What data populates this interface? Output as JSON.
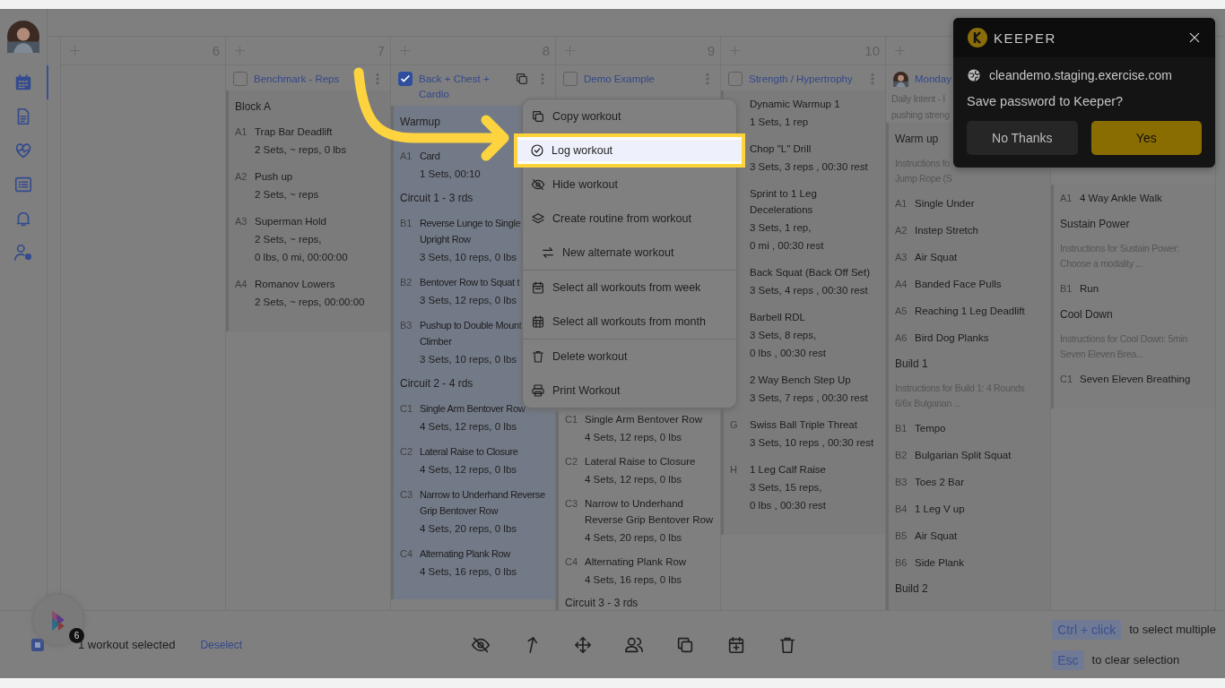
{
  "sidebar": {
    "items": [
      {
        "kind": "calendar",
        "selected": true
      },
      {
        "kind": "document",
        "selected": false
      },
      {
        "kind": "heart",
        "selected": false
      },
      {
        "kind": "list",
        "selected": false
      },
      {
        "kind": "bell",
        "selected": false
      },
      {
        "kind": "user-settings",
        "selected": false
      }
    ]
  },
  "columns": [
    {
      "day": "6",
      "add_button": true
    },
    {
      "day": "7",
      "add_button": true,
      "workouts": [
        {
          "title": "Benchmark - Reps",
          "checked": false,
          "sections": [
            {
              "heading": "Block A",
              "exercises": [
                {
                  "code": "A1",
                  "name": "Trap Bar Deadlift",
                  "details": [
                    "2 Sets, ~ reps, 0 lbs"
                  ]
                },
                {
                  "code": "A2",
                  "name": "Push up",
                  "details": [
                    "2 Sets, ~ reps"
                  ]
                },
                {
                  "code": "A3",
                  "name": "Superman Hold",
                  "details": [
                    "2 Sets, ~ reps,",
                    "0 lbs, 0 mi, 00:00:00"
                  ]
                },
                {
                  "code": "A4",
                  "name": "Romanov Lowers",
                  "details": [
                    "2 Sets, ~ reps, 00:00:00"
                  ]
                }
              ]
            }
          ]
        }
      ]
    },
    {
      "day": "8",
      "add_button": true,
      "workouts": [
        {
          "title": "Back + Chest + Cardio",
          "checked": true,
          "copy_icon": true,
          "sections": [
            {
              "heading": "Warmup",
              "exercises": [
                {
                  "code": "A1",
                  "name": "Card",
                  "details": [
                    "1 Sets, 00:10"
                  ]
                }
              ]
            },
            {
              "heading": "Circuit 1 - 3 rds",
              "exercises": [
                {
                  "code": "B1",
                  "name": "Reverse Lunge to Single Upright Row",
                  "details": [
                    "3 Sets, 10 reps, 0 lbs"
                  ]
                },
                {
                  "code": "B2",
                  "name": "Bentover Row to Squat t",
                  "details": [
                    "3 Sets, 12 reps, 0 lbs"
                  ]
                },
                {
                  "code": "B3",
                  "name": "Pushup to Double Mount Climber",
                  "details": [
                    "3 Sets, 10 reps, 0 lbs"
                  ]
                }
              ]
            },
            {
              "heading": "Circuit 2 - 4 rds",
              "exercises": [
                {
                  "code": "C1",
                  "name": "Single Arm Bentover Row",
                  "details": [
                    "4 Sets, 12 reps, 0 lbs"
                  ]
                },
                {
                  "code": "C2",
                  "name": "Lateral Raise to Closure",
                  "details": [
                    "4 Sets, 12 reps, 0 lbs"
                  ]
                },
                {
                  "code": "C3",
                  "name": "Narrow to Underhand Reverse Grip Bentover Row",
                  "details": [
                    "4 Sets, 20 reps, 0 lbs"
                  ]
                },
                {
                  "code": "C4",
                  "name": "Alternating Plank Row",
                  "details": [
                    "4 Sets, 16 reps, 0 lbs"
                  ]
                }
              ]
            }
          ]
        }
      ]
    },
    {
      "day": "9",
      "add_button": true,
      "workouts": [
        {
          "title": "Demo Example",
          "checked": false,
          "sections": [
            {
              "exercises": [
                {
                  "code": "C1",
                  "name": "Single Arm Bentover Row",
                  "details": [
                    "4 Sets, 12 reps, 0 lbs"
                  ]
                },
                {
                  "code": "C2",
                  "name": "Lateral Raise to Closure",
                  "details": [
                    "4 Sets, 12 reps, 0 lbs"
                  ]
                },
                {
                  "code": "C3",
                  "name": "Narrow to Underhand Reverse Grip Bentover Row",
                  "details": [
                    "4 Sets, 20 reps, 0 lbs"
                  ]
                },
                {
                  "code": "C4",
                  "name": "Alternating Plank Row",
                  "details": [
                    "4 Sets, 16 reps, 0 lbs"
                  ]
                }
              ]
            },
            {
              "heading": "Circuit 3 - 3 rds"
            }
          ]
        }
      ]
    },
    {
      "day": "10",
      "add_button": true,
      "workouts": [
        {
          "title": "Strength / Hypertrophy",
          "checked": false,
          "sections": [
            {
              "exercises": [
                {
                  "name": "Dynamic Warmup 1",
                  "details": [
                    "1 Sets, 1 rep"
                  ]
                },
                {
                  "name": "Chop \"L\" Drill",
                  "details": [
                    "3 Sets, 3 reps , 00:30 rest"
                  ]
                },
                {
                  "name": "Sprint to 1 Leg Decelerations",
                  "details": [
                    "3 Sets, 1 rep,",
                    "0 mi , 00:30 rest"
                  ]
                },
                {
                  "name": "Back Squat (Back Off Set)",
                  "details": [
                    "3 Sets, 4 reps , 00:30 rest"
                  ]
                },
                {
                  "name": "Barbell RDL",
                  "details": [
                    "3 Sets, 8 reps,",
                    "0 lbs , 00:30 rest"
                  ]
                },
                {
                  "name": "2 Way Bench Step Up",
                  "details": [
                    "3 Sets, 7 reps , 00:30 rest"
                  ]
                },
                {
                  "code": "G",
                  "name": "Swiss Ball Triple Threat",
                  "details": [
                    "3 Sets, 10 reps , 00:30 rest"
                  ]
                },
                {
                  "code": "H",
                  "name": "1 Leg Calf Raise",
                  "details": [
                    "3 Sets, 15 reps,",
                    "0 lbs , 00:30 rest"
                  ]
                }
              ]
            }
          ]
        }
      ]
    },
    {
      "add_button": true,
      "workouts": [
        {
          "title": "Monday",
          "avatar": true,
          "description": [
            "Daily Intent - I",
            "pushing streng"
          ],
          "sections": [
            {
              "heading": "Warm up",
              "instructions": [
                "Instructions fo",
                "Jump Rope (S"
              ],
              "exercises": [
                {
                  "code": "A1",
                  "name": "Single Under"
                },
                {
                  "code": "A2",
                  "name": "Instep Stretch"
                },
                {
                  "code": "A3",
                  "name": "Air Squat"
                },
                {
                  "code": "A4",
                  "name": "Banded Face Pulls"
                },
                {
                  "code": "A5",
                  "name": "Reaching 1 Leg Deadlift"
                },
                {
                  "code": "A6",
                  "name": "Bird Dog Planks"
                }
              ]
            },
            {
              "heading": "Build 1",
              "instructions": [
                "Instructions for Build 1: 4 Rounds",
                "6/6x Bulgarian ..."
              ],
              "exercises": [
                {
                  "code": "B1",
                  "name": "Tempo"
                },
                {
                  "code": "B2",
                  "name": "Bulgarian Split Squat"
                },
                {
                  "code": "B3",
                  "name": "Toes 2 Bar"
                },
                {
                  "code": "B4",
                  "name": "1 Leg V up"
                },
                {
                  "code": "B5",
                  "name": "Air Squat"
                },
                {
                  "code": "B6",
                  "name": "Side Plank"
                }
              ]
            },
            {
              "heading": "Build 2"
            }
          ]
        }
      ]
    },
    {
      "workouts": [
        {
          "sections": [
            {
              "exercises": [
                {
                  "code": "A1",
                  "name": "4 Way Ankle Walk"
                }
              ]
            },
            {
              "heading": "Sustain Power",
              "instructions": [
                "Instructions for Sustain Power:",
                "Choose a modality ..."
              ],
              "exercises": [
                {
                  "code": "B1",
                  "name": "Run"
                }
              ]
            },
            {
              "heading": "Cool Down",
              "instructions": [
                "Instructions for Cool Down: 5min",
                "Seven Eleven Brea..."
              ],
              "exercises": [
                {
                  "code": "C1",
                  "name": "Seven Eleven Breathing"
                }
              ]
            }
          ]
        }
      ]
    }
  ],
  "context_menu": {
    "items": [
      {
        "label": "Copy workout",
        "kind": "copy",
        "selected": false
      },
      {
        "label": "Log workout",
        "kind": "check-circle",
        "selected": true
      },
      {
        "label": "Hide workout",
        "kind": "eye-off",
        "selected": false
      },
      {
        "label": "Create routine from workout",
        "kind": "layers",
        "selected": false
      },
      {
        "label": "New alternate workout",
        "kind": "swap",
        "selected": false
      },
      {
        "label": "Select all workouts from week",
        "kind": "calendar-week",
        "divider_before": true,
        "selected": false
      },
      {
        "label": "Select all workouts from month",
        "kind": "calendar-month",
        "selected": false
      },
      {
        "label": "Delete workout",
        "kind": "trash",
        "divider_before": true,
        "selected": false
      },
      {
        "label": "Print Workout",
        "kind": "printer",
        "selected": false
      }
    ]
  },
  "selection_bar": {
    "badge": "6",
    "select_all_checked": true,
    "count_text": "1 workout selected",
    "deselect": "Deselect",
    "actions": [
      {
        "kind": "eye-off"
      },
      {
        "kind": "share"
      },
      {
        "kind": "move"
      },
      {
        "kind": "users"
      },
      {
        "kind": "copy"
      },
      {
        "kind": "calendar-plus"
      },
      {
        "kind": "trash"
      }
    ],
    "hints": [
      {
        "key": "Ctrl + click",
        "text": "to select multiple"
      },
      {
        "key": "Esc",
        "text": "to clear selection"
      }
    ]
  },
  "password_popup": {
    "brand": "KEEPER",
    "site": "cleandemo.staging.exercise.com",
    "question": "Save password to Keeper?",
    "buttons": [
      {
        "label": "No Thanks",
        "kind": "secondary"
      },
      {
        "label": "Yes",
        "kind": "primary"
      }
    ]
  }
}
